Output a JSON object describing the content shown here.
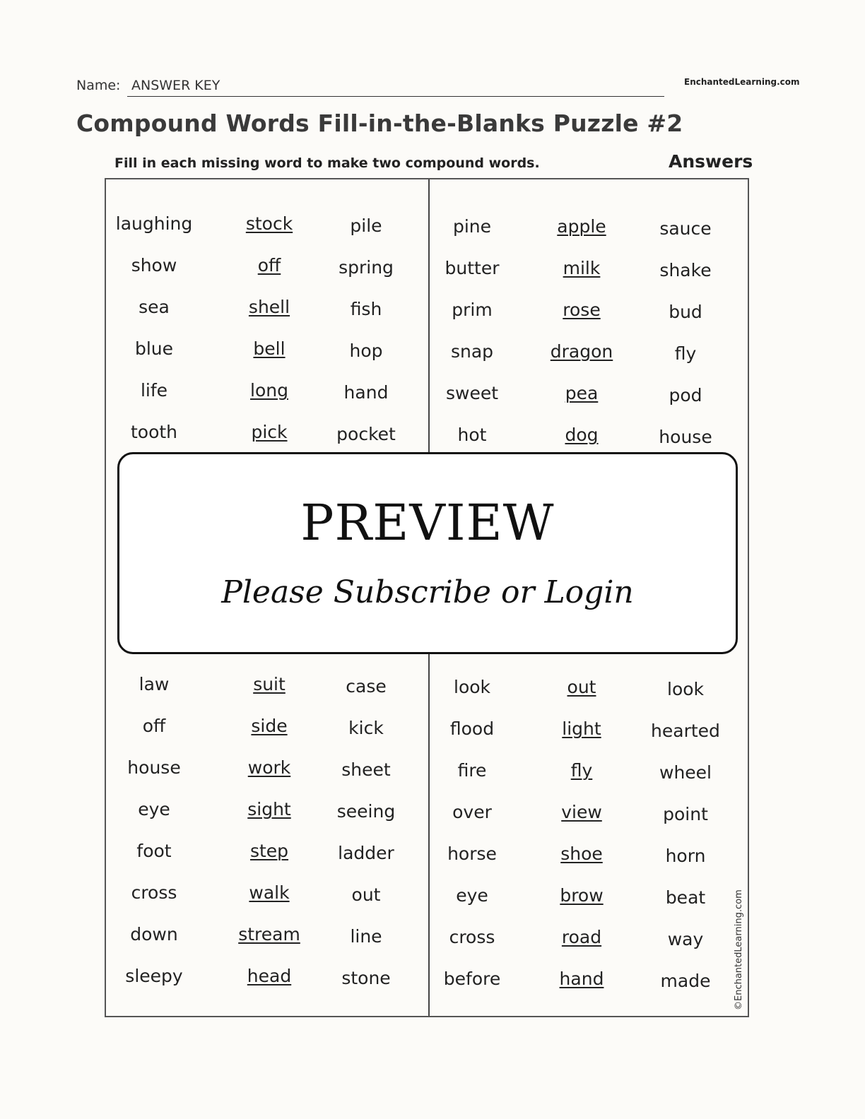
{
  "header": {
    "name_label": "Name:",
    "name_value": "ANSWER KEY",
    "brand": "EnchantedLearning.com",
    "title": "Compound Words Fill-in-the-Blanks Puzzle #2",
    "instructions": "Fill in each missing word to make two compound words.",
    "answers_label": "Answers"
  },
  "left_top": [
    {
      "first": "laughing",
      "answer": "stock",
      "last": "pile"
    },
    {
      "first": "show",
      "answer": "off",
      "last": "spring"
    },
    {
      "first": "sea",
      "answer": "shell",
      "last": "fish"
    },
    {
      "first": "blue",
      "answer": "bell",
      "last": "hop"
    },
    {
      "first": "life",
      "answer": "long",
      "last": "hand"
    },
    {
      "first": "tooth",
      "answer": "pick",
      "last": "pocket"
    }
  ],
  "right_top": [
    {
      "first": "pine",
      "answer": "apple",
      "last": "sauce"
    },
    {
      "first": "butter",
      "answer": "milk",
      "last": "shake"
    },
    {
      "first": "prim",
      "answer": "rose",
      "last": "bud"
    },
    {
      "first": "snap",
      "answer": "dragon",
      "last": "fly"
    },
    {
      "first": "sweet",
      "answer": "pea",
      "last": "pod"
    },
    {
      "first": "hot",
      "answer": "dog",
      "last": "house"
    }
  ],
  "left_bottom": [
    {
      "first": "law",
      "answer": "suit",
      "last": "case"
    },
    {
      "first": "off",
      "answer": "side",
      "last": "kick"
    },
    {
      "first": "house",
      "answer": "work",
      "last": "sheet"
    },
    {
      "first": "eye",
      "answer": "sight",
      "last": "seeing"
    },
    {
      "first": "foot",
      "answer": "step",
      "last": "ladder"
    },
    {
      "first": "cross",
      "answer": "walk",
      "last": "out"
    },
    {
      "first": "down",
      "answer": "stream",
      "last": "line"
    },
    {
      "first": "sleepy",
      "answer": "head",
      "last": "stone"
    }
  ],
  "right_bottom": [
    {
      "first": "look",
      "answer": "out",
      "last": "look"
    },
    {
      "first": "flood",
      "answer": "light",
      "last": "hearted"
    },
    {
      "first": "fire",
      "answer": "fly",
      "last": "wheel"
    },
    {
      "first": "over",
      "answer": "view",
      "last": "point"
    },
    {
      "first": "horse",
      "answer": "shoe",
      "last": "horn"
    },
    {
      "first": "eye",
      "answer": "brow",
      "last": "beat"
    },
    {
      "first": "cross",
      "answer": "road",
      "last": "way"
    },
    {
      "first": "before",
      "answer": "hand",
      "last": "made"
    }
  ],
  "copyright": "©EnchantedLearning.com",
  "preview": {
    "title": "PREVIEW",
    "subtitle": "Please Subscribe or Login"
  }
}
